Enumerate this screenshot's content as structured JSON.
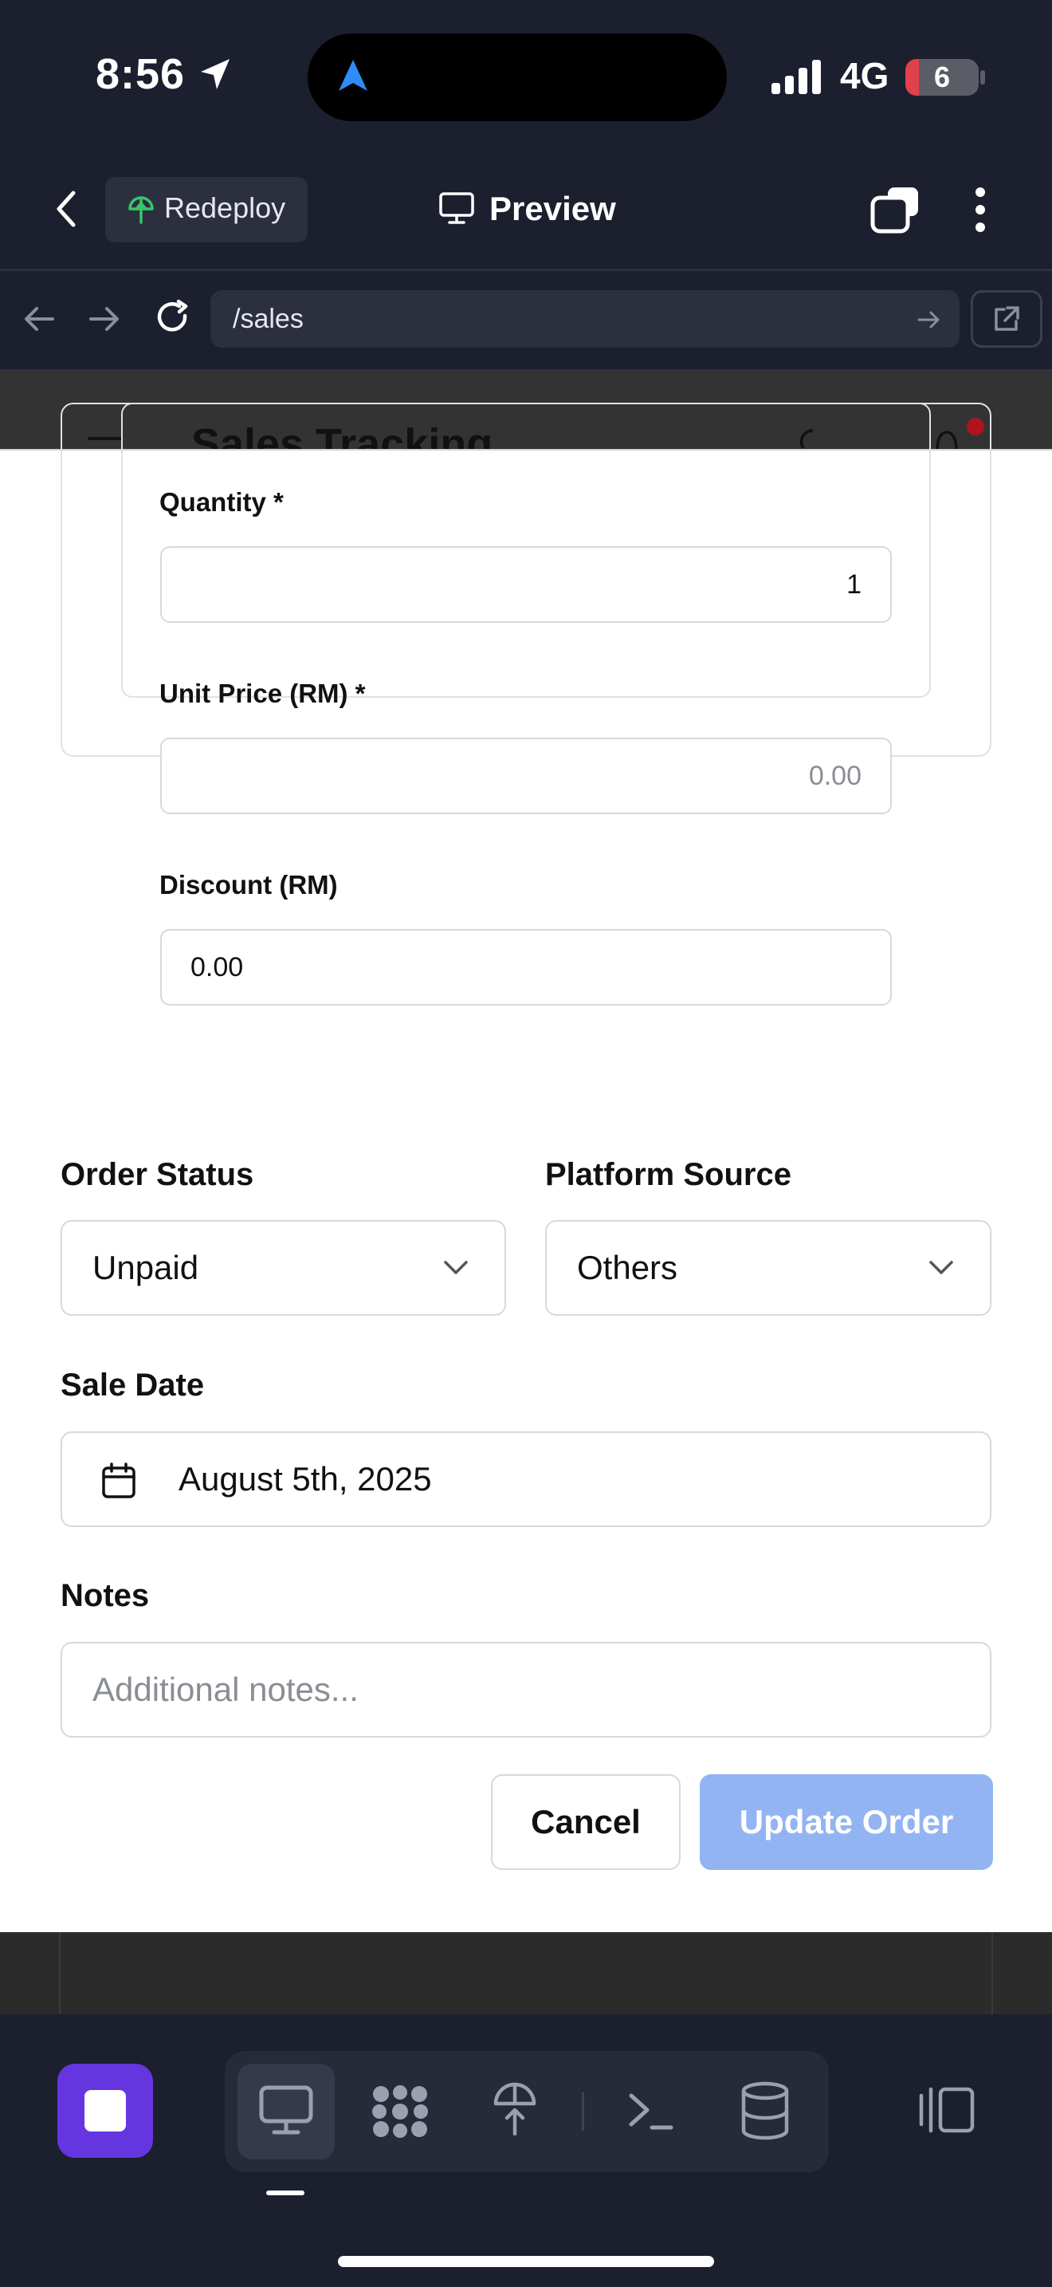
{
  "status_bar": {
    "time": "8:56",
    "network": "4G",
    "battery": "6",
    "battery_level": 0.06,
    "colors": {
      "battery_low": "#e0414a"
    }
  },
  "app_header": {
    "redeploy_label": "Redeploy",
    "preview_label": "Preview",
    "icons": [
      "back-chevron-icon",
      "redeploy-icon",
      "monitor-icon",
      "tabs-icon",
      "more-vertical-icon"
    ]
  },
  "url_bar": {
    "url": "/sales",
    "icons": [
      "back-arrow-icon",
      "forward-arrow-icon",
      "reload-icon",
      "go-arrow-icon",
      "external-link-icon"
    ]
  },
  "background_app": {
    "title": "Sales Tracking"
  },
  "form": {
    "item": {
      "quantity_label": "Quantity *",
      "quantity_value": "1",
      "unit_price_label": "Unit Price (RM) *",
      "unit_price_placeholder": "0.00",
      "discount_label": "Discount (RM)",
      "discount_value": "0.00"
    },
    "order_status": {
      "label": "Order Status",
      "value": "Unpaid"
    },
    "platform_source": {
      "label": "Platform Source",
      "value": "Others"
    },
    "sale_date": {
      "label": "Sale Date",
      "value": "August 5th, 2025"
    },
    "notes": {
      "label": "Notes",
      "placeholder": "Additional notes..."
    },
    "buttons": {
      "cancel": "Cancel",
      "update": "Update Order"
    },
    "colors": {
      "update_button": "#93b4f2"
    }
  },
  "bottom_toolbar": {
    "colors": {
      "stop_button": "#6536e0"
    },
    "tools": [
      "monitor-icon",
      "apps-icon",
      "deploy-icon",
      "terminal-icon",
      "database-icon",
      "split-view-icon"
    ]
  }
}
